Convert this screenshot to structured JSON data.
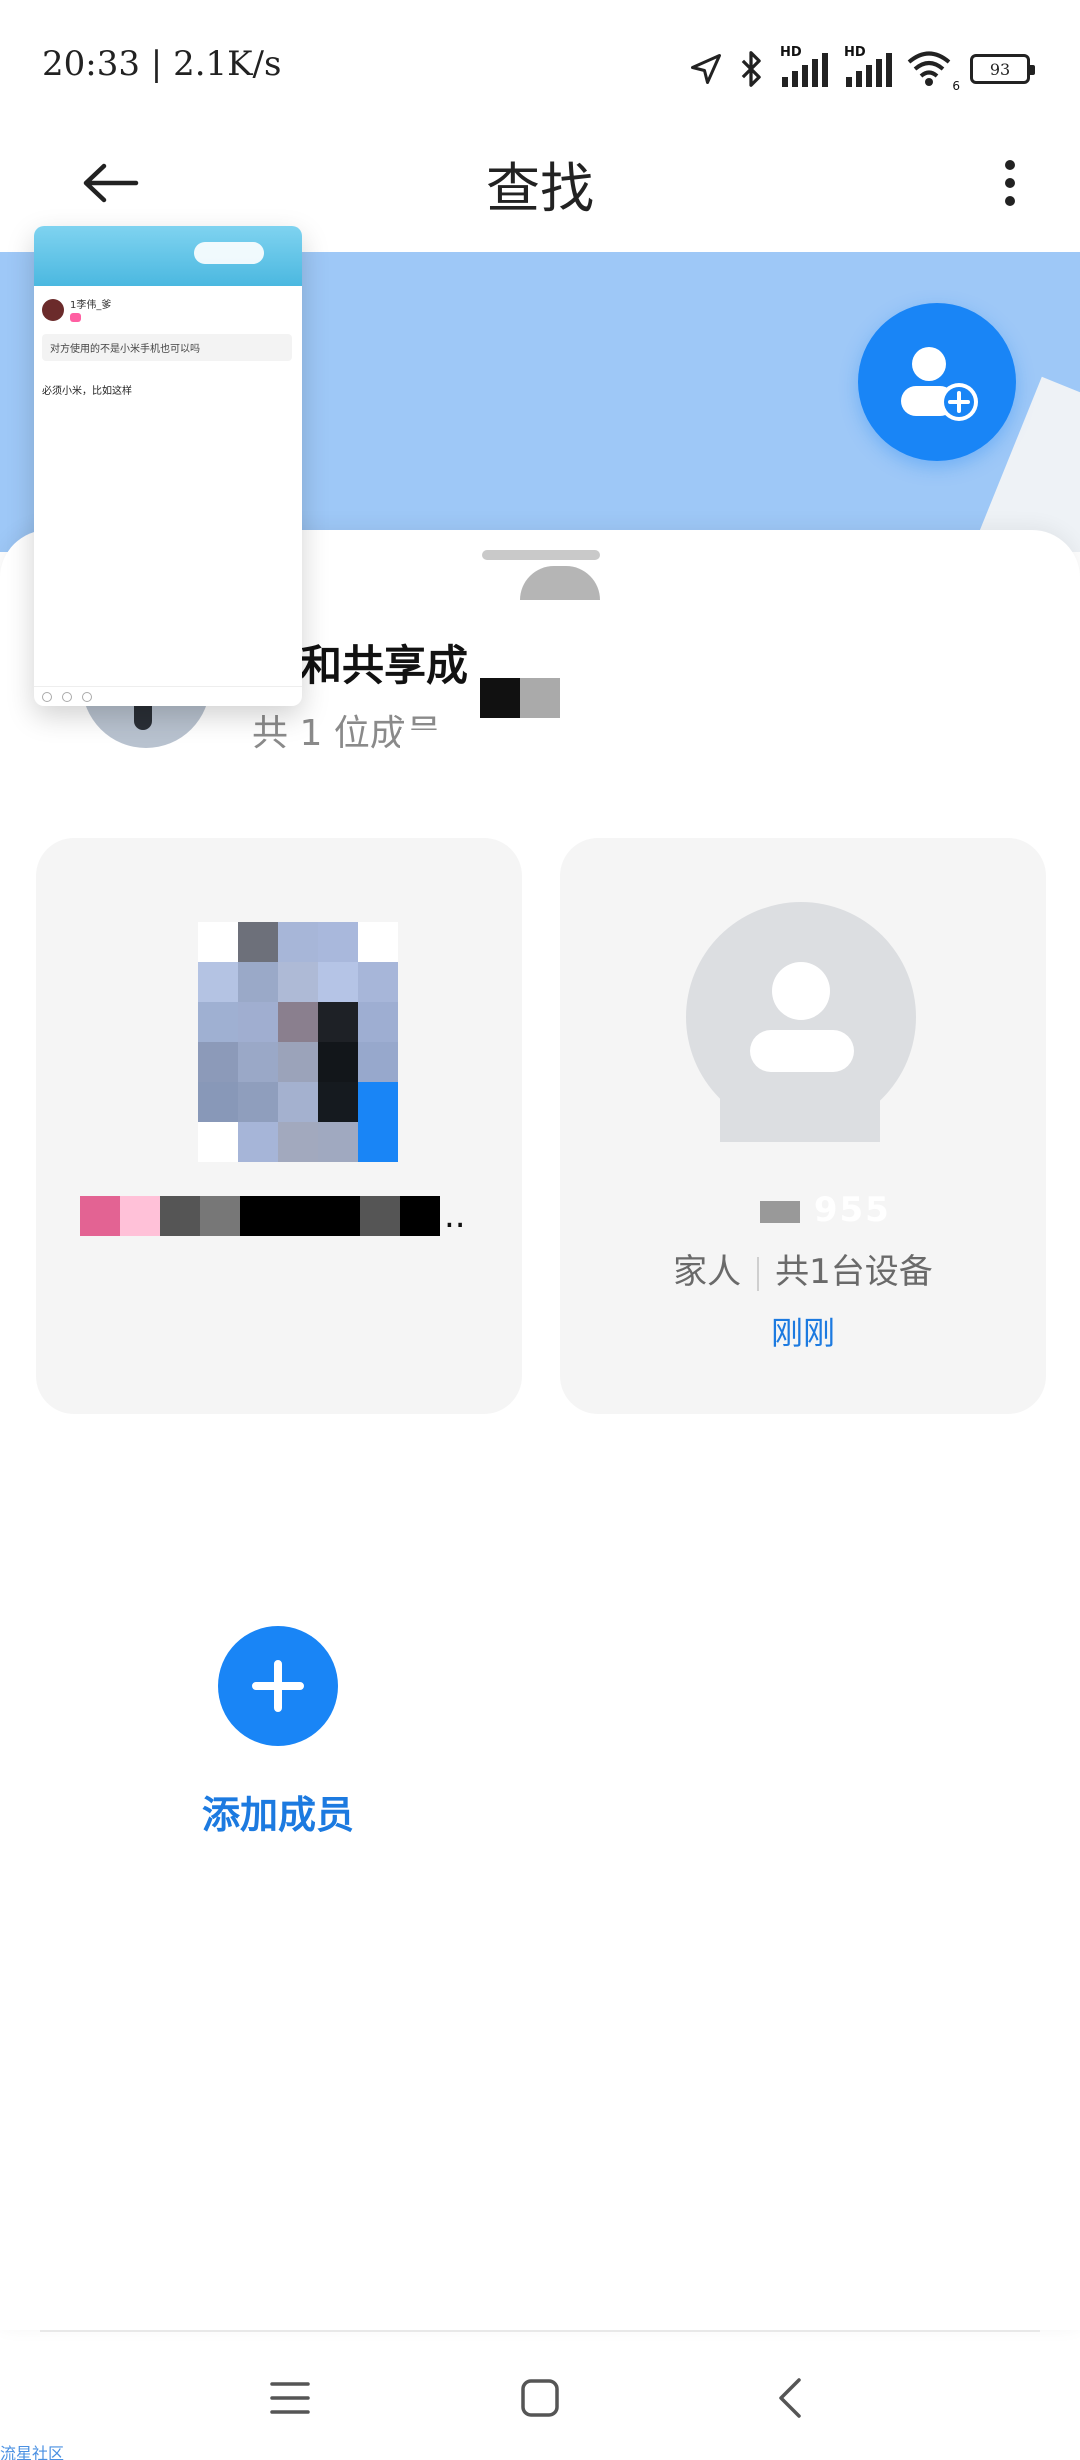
{
  "status_bar": {
    "time": "20:33",
    "speed": "2.1K/s",
    "network_1": "HD",
    "network_2": "HD",
    "wifi_badge": "6",
    "battery": "93"
  },
  "header": {
    "title": "查找"
  },
  "recent_preview": {
    "username": "1李伟_爹",
    "quote": "对方使用的不是小米手机也可以吗",
    "reply": "必须小米，比如这样"
  },
  "group": {
    "title": "和共享成",
    "count": "共 1 位成员"
  },
  "members": [
    {
      "name_visible": "..",
      "relation": "",
      "devices": "",
      "time": ""
    },
    {
      "name_visible": "955",
      "relation": "家人",
      "devices": "共1台设备",
      "time": "刚刚"
    }
  ],
  "add_member": {
    "label": "添加成员"
  },
  "watermark": "流星社区",
  "colors": {
    "accent": "#1985f6",
    "map_blue": "#9ec8f7",
    "link_blue": "#1c7ae0",
    "card_bg": "#f5f5f5"
  },
  "icons": {
    "back": "arrow-left-icon",
    "more": "more-vertical-icon",
    "add_member_fab": "user-plus-icon",
    "add": "plus-icon",
    "nav_menu": "menu-icon",
    "nav_home": "home-square-icon",
    "nav_back": "chevron-left-icon"
  }
}
